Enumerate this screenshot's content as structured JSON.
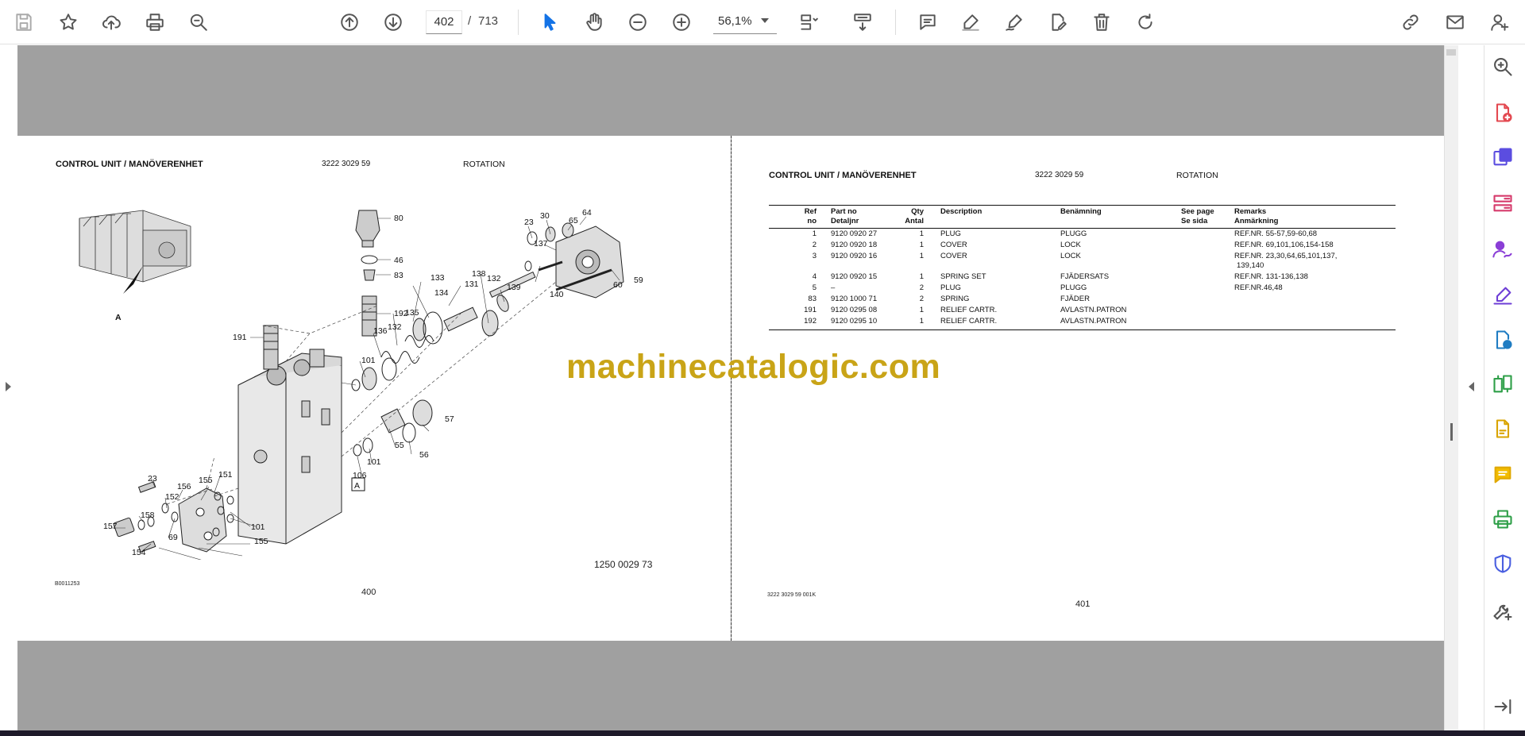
{
  "toolbar": {
    "current_page": "402",
    "page_separator": "/",
    "total_pages": "713",
    "zoom": "56,1%"
  },
  "left_page": {
    "title": "CONTROL UNIT / MANÖVERENHET",
    "part_no": "3222 3029 59",
    "section": "ROTATION",
    "figure_number": "1250 0029 73",
    "figure_code": "B0011253",
    "page_number": "400",
    "view_label": "A",
    "box_label": "A",
    "callouts": [
      "80",
      "46",
      "83",
      "192",
      "191",
      "23",
      "30",
      "65",
      "64",
      "137",
      "139",
      "138",
      "131",
      "132",
      "133",
      "134",
      "135",
      "132",
      "136",
      "101",
      "140",
      "60",
      "59",
      "57",
      "56",
      "55",
      "101",
      "106",
      "156",
      "155",
      "151",
      "23",
      "152",
      "158",
      "157",
      "69",
      "154",
      "101",
      "155"
    ]
  },
  "right_page": {
    "title": "CONTROL UNIT / MANÖVERENHET",
    "part_no": "3222 3029 59",
    "section": "ROTATION",
    "doc_code": "3222 3029 59 001K",
    "page_number": "401",
    "table": {
      "headers": {
        "ref": [
          "Ref",
          "no"
        ],
        "part": [
          "Part no",
          "Detaljnr"
        ],
        "qty": [
          "Qty",
          "Antal"
        ],
        "desc": [
          "Description",
          ""
        ],
        "ben": [
          "Benämning",
          ""
        ],
        "see": [
          "See page",
          "Se sida"
        ],
        "rem": [
          "Remarks",
          "Anmärkning"
        ]
      },
      "rows": [
        {
          "ref": "1",
          "part": "9120 0920 27",
          "qty": "1",
          "desc": "PLUG",
          "ben": "PLUGG",
          "see": "",
          "rem": "REF.NR. 55-57,59-60,68"
        },
        {
          "ref": "2",
          "part": "9120 0920 18",
          "qty": "1",
          "desc": "COVER",
          "ben": "LOCK",
          "see": "",
          "rem": "REF.NR. 69,101,106,154-158"
        },
        {
          "ref": "3",
          "part": "9120 0920 16",
          "qty": "1",
          "desc": "COVER",
          "ben": "LOCK",
          "see": "",
          "rem": "REF.NR. 23,30,64,65,101,137,",
          "rem2": "139,140"
        },
        {
          "ref": "4",
          "part": "9120 0920 15",
          "qty": "1",
          "desc": "SPRING SET",
          "ben": "FJÄDERSATS",
          "see": "",
          "rem": "REF.NR. 131-136,138"
        },
        {
          "ref": "5",
          "part": "–",
          "qty": "2",
          "desc": "PLUG",
          "ben": "PLUGG",
          "see": "",
          "rem": "REF.NR.46,48"
        },
        {
          "ref": "83",
          "part": "9120 1000 71",
          "qty": "2",
          "desc": "SPRING",
          "ben": "FJÄDER",
          "see": "",
          "rem": ""
        },
        {
          "ref": "191",
          "part": "9120 0295 08",
          "qty": "1",
          "desc": "RELIEF CARTR.",
          "ben": "AVLASTN.PATRON",
          "see": "",
          "rem": ""
        },
        {
          "ref": "192",
          "part": "9120 0295 10",
          "qty": "1",
          "desc": "RELIEF CARTR.",
          "ben": "AVLASTN.PATRON",
          "see": "",
          "rem": ""
        }
      ]
    }
  },
  "watermark": "machinecatalogic.com",
  "icons": {
    "toolbar": [
      "save-icon",
      "star-icon",
      "cloud-upload-icon",
      "print-icon",
      "zoom-search-icon",
      "page-up-icon",
      "page-down-icon",
      "select-arrow-icon",
      "hand-icon",
      "zoom-out-icon",
      "zoom-in-icon",
      "fit-page-icon",
      "scroll-mode-icon",
      "comment-icon",
      "highlight-icon",
      "draw-icon",
      "edit-pdf-icon",
      "delete-icon",
      "rotate-icon",
      "share-link-icon",
      "mail-icon",
      "add-user-icon"
    ],
    "sidebar": [
      "zoom-search-icon",
      "create-pdf-icon",
      "export-pdf-icon",
      "organize-pages-icon",
      "request-signature-icon",
      "fill-sign-icon",
      "send-file-icon",
      "compare-icon",
      "edit-pdf-icon",
      "comment-icon",
      "print-production-icon",
      "protect-icon",
      "more-tools-icon",
      "collapse-panel-icon"
    ]
  },
  "colors": {
    "accent_blue": "#1473e6",
    "watermark": "#c9a417",
    "viewer_bg": "#a0a0a0"
  }
}
